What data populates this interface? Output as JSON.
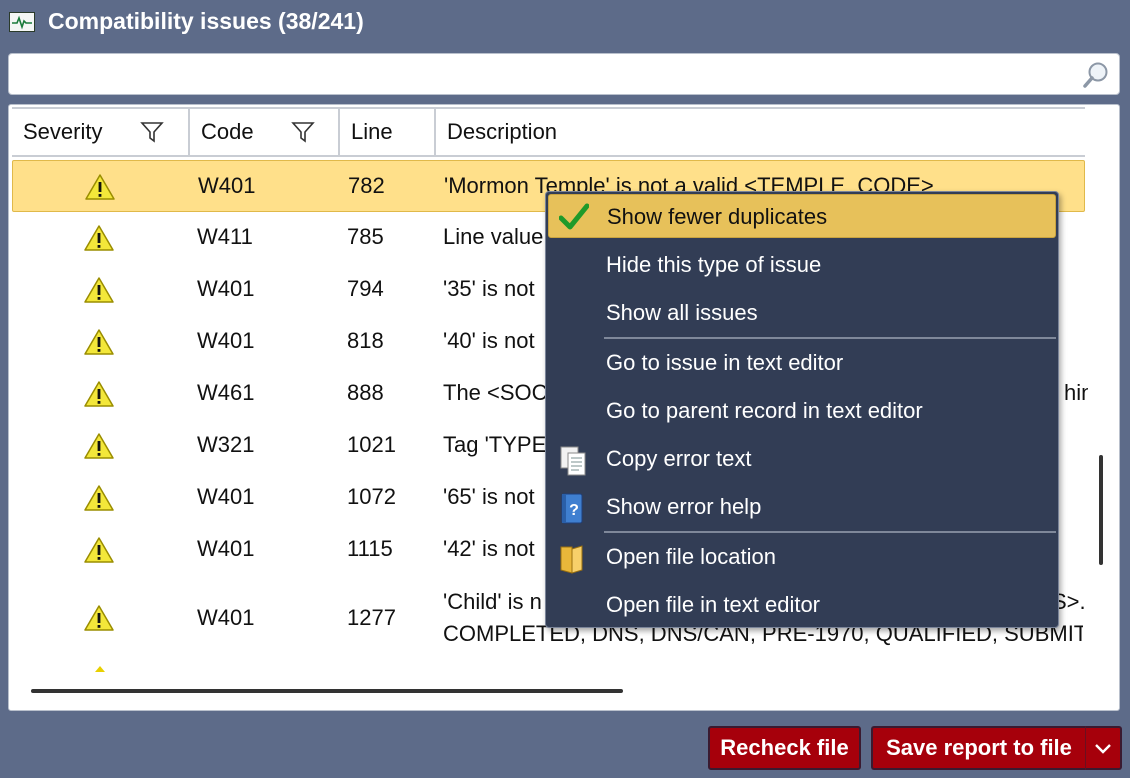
{
  "window": {
    "title": "Compatibility issues (38/241)",
    "icon": "monitor-pulse-icon"
  },
  "search": {
    "value": "",
    "placeholder": "",
    "icon": "magnifier-icon"
  },
  "table": {
    "columns": {
      "severity": "Severity",
      "code": "Code",
      "line": "Line",
      "description": "Description"
    },
    "rows": [
      {
        "severity": "warning",
        "code": "W401",
        "line": "782",
        "description": "'Mormon Temple' is not a valid <TEMPLE_CODE>"
      },
      {
        "severity": "warning",
        "code": "W411",
        "line": "785",
        "description": "Line value"
      },
      {
        "severity": "warning",
        "code": "W401",
        "line": "794",
        "description": "'35' is not"
      },
      {
        "severity": "warning",
        "code": "W401",
        "line": "818",
        "description": "'40' is not"
      },
      {
        "severity": "warning",
        "code": "W461",
        "line": "888",
        "description": "The <SOC",
        "description_tail": "hin"
      },
      {
        "severity": "warning",
        "code": "W321",
        "line": "1021",
        "description": "Tag 'TYPE"
      },
      {
        "severity": "warning",
        "code": "W401",
        "line": "1072",
        "description": "'65' is not"
      },
      {
        "severity": "warning",
        "code": "W401",
        "line": "1115",
        "description": "'42' is not"
      },
      {
        "severity": "warning",
        "code": "W401",
        "line": "1277",
        "description": "'Child' is n",
        "description_tail": "S>.",
        "description_line2": "COMPLETED, DNS, DNS/CAN, PRE-1970, QUALIFIED, SUBMIT"
      }
    ]
  },
  "context_menu": {
    "items": [
      {
        "label": "Show fewer duplicates",
        "icon": "checkmark-icon",
        "active": true
      },
      {
        "label": "Hide this type of issue"
      },
      {
        "label": "Show all issues"
      },
      {
        "label": "Go to issue in text editor"
      },
      {
        "label": "Go to parent record in text editor"
      },
      {
        "label": "Copy error text",
        "icon": "copy-document-icon"
      },
      {
        "label": "Show error help",
        "icon": "help-book-icon"
      },
      {
        "label": "Open file location",
        "icon": "folder-icon"
      },
      {
        "label": "Open file in text editor"
      }
    ]
  },
  "buttons": {
    "recheck": "Recheck file",
    "save_report": "Save report to file"
  },
  "colors": {
    "background": "#5d6b89",
    "selected_row": "#ffe08a",
    "menu_background": "#323d55",
    "menu_highlight": "#e7c15a",
    "button_red": "#a6000b"
  }
}
